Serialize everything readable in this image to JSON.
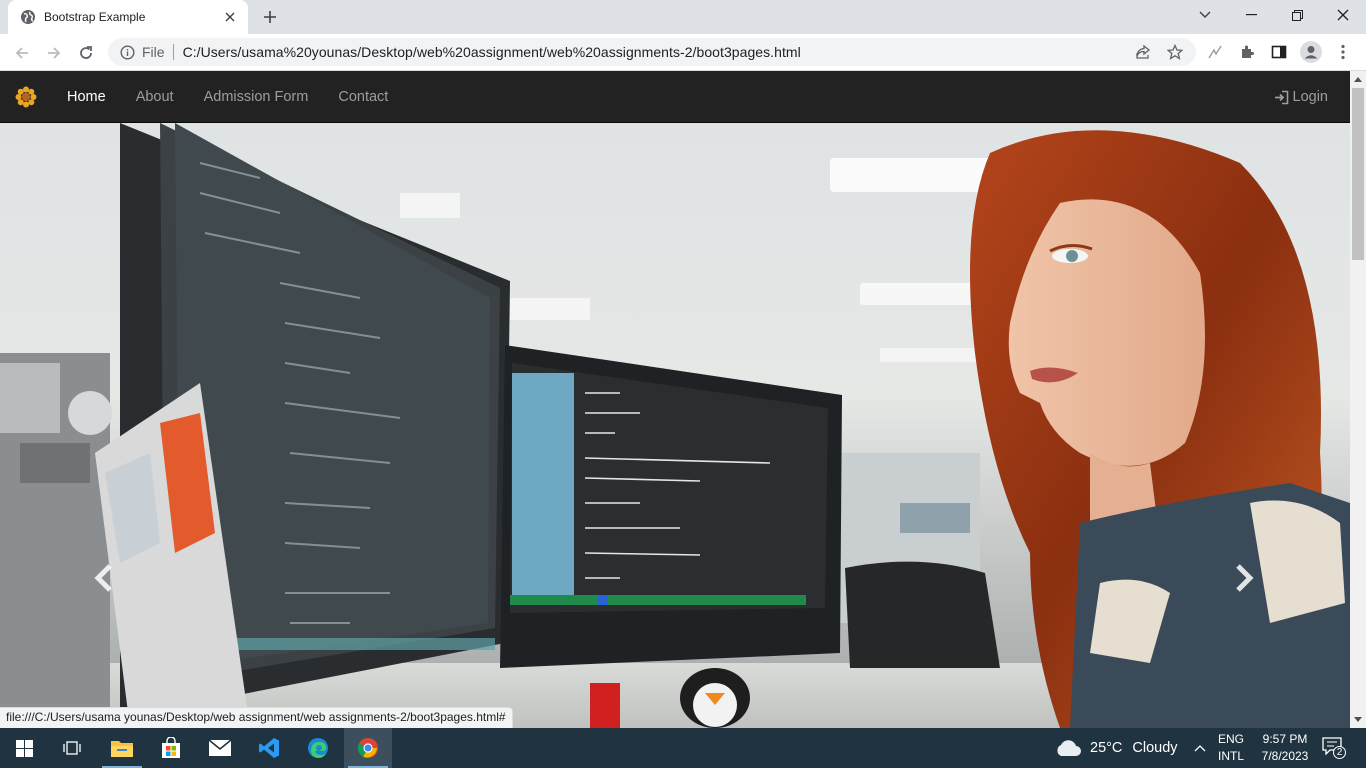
{
  "browser": {
    "tab_title": "Bootstrap Example",
    "omnibox_scheme_label": "File",
    "url": "C:/Users/usama%20younas/Desktop/web%20assignment/web%20assignments-2/boot3pages.html",
    "status_url": "file:///C:/Users/usama younas/Desktop/web assignment/web assignments-2/boot3pages.html#"
  },
  "navbar": {
    "links": [
      {
        "label": "Home",
        "active": true
      },
      {
        "label": "About",
        "active": false
      },
      {
        "label": "Admission Form",
        "active": false
      },
      {
        "label": "Contact",
        "active": false
      }
    ],
    "login_label": "Login"
  },
  "carousel": {
    "image_icon": "woman-at-computer-photo",
    "prev_icon": "chevron-left-icon",
    "next_icon": "chevron-right-icon"
  },
  "taskbar": {
    "weather_temp": "25°C",
    "weather_condition": "Cloudy",
    "lang_line1": "ENG",
    "lang_line2": "INTL",
    "time": "9:57 PM",
    "date": "7/8/2023",
    "notification_count": "2"
  },
  "colors": {
    "navbar_bg": "#222222",
    "nav_link": "#9d9d9d",
    "nav_active": "#ffffff",
    "taskbar_bg": "#1f3340"
  }
}
